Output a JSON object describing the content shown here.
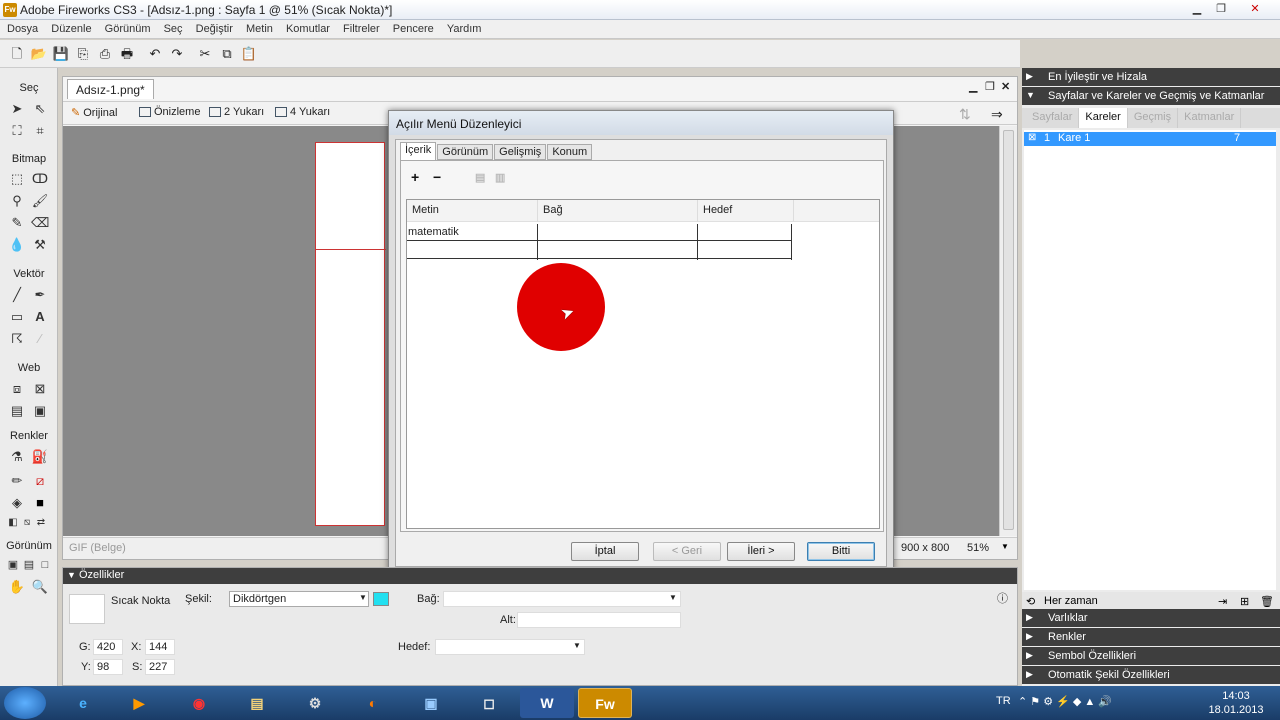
{
  "window": {
    "app_badge": "Fw",
    "title": "Adobe Fireworks CS3 - [Adsız-1.png : Sayfa 1 @  51% (Sıcak Nokta)*]"
  },
  "menu": [
    "Dosya",
    "Düzenle",
    "Görünüm",
    "Seç",
    "Değiştir",
    "Metin",
    "Komutlar",
    "Filtreler",
    "Pencere",
    "Yardım"
  ],
  "tools_panel": {
    "sections": [
      "Seç",
      "Bitmap",
      "Vektör",
      "Web",
      "Renkler",
      "Görünüm"
    ]
  },
  "document": {
    "tab": "Adsız-1.png*",
    "views": [
      "Orijinal",
      "Önizleme",
      "2 Yukarı",
      "4 Yukarı"
    ],
    "format": "GIF (Belge)",
    "size": "900 x 800",
    "zoom": "51%"
  },
  "dialog": {
    "title": "Açılır Menü Düzenleyici",
    "tabs": [
      "İçerik",
      "Görünüm",
      "Gelişmiş",
      "Konum"
    ],
    "columns": [
      "Metin",
      "Bağ",
      "Hedef"
    ],
    "rows": [
      {
        "text": "matematik",
        "link": "",
        "target": ""
      }
    ],
    "buttons": {
      "cancel": "İptal",
      "back": "< Geri",
      "next": "İleri >",
      "finish": "Bitti"
    }
  },
  "right_panel": {
    "optimize_align": "En İyileştir ve Hizala",
    "pages_frames": "Sayfalar ve Kareler ve Geçmiş ve Katmanlar",
    "tabs": [
      "Sayfalar",
      "Kareler",
      "Geçmiş",
      "Katmanlar"
    ],
    "frame_row": {
      "index": "1",
      "name": "Kare 1",
      "delay": "7"
    },
    "loop": "Her zaman",
    "sections": [
      "Varlıklar",
      "Renkler",
      "Sembol Özellikleri",
      "Otomatik Şekil Özellikleri"
    ]
  },
  "properties": {
    "title": "Özellikler",
    "object_name": "Sıcak Nokta",
    "shape_label": "Şekil:",
    "shape_value": "Dikdörtgen",
    "link_label": "Bağ:",
    "alt_label": "Alt:",
    "target_label": "Hedef:",
    "w_label": "G:",
    "w_value": "420",
    "h_label": "Y:",
    "h_value": "98",
    "x_label": "X:",
    "x_value": "144",
    "y_label": "S:",
    "y_value": "227",
    "swatch_color": "#22e0f0"
  },
  "taskbar": {
    "lang": "TR",
    "time": "14:03",
    "date": "18.01.2013",
    "word_label": "W",
    "fw_label": "Fw"
  }
}
